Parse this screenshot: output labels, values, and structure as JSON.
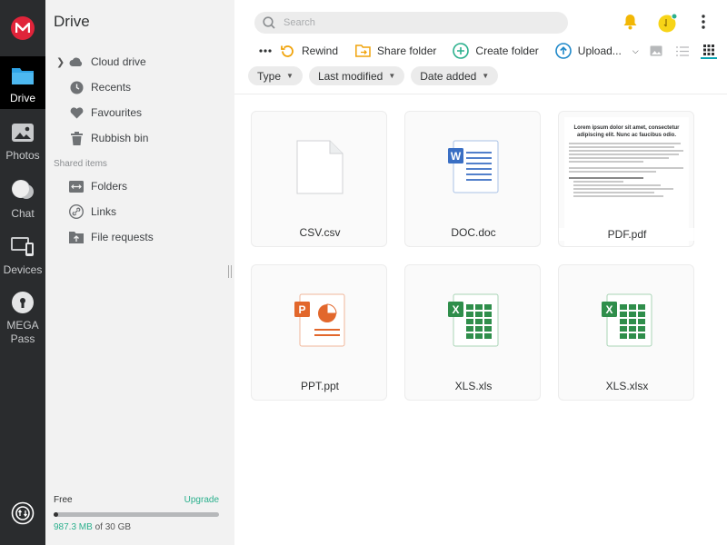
{
  "app": {
    "section_title": "Drive"
  },
  "rail": {
    "items": [
      {
        "label": "Drive",
        "icon": "folder-icon"
      },
      {
        "label": "Photos",
        "icon": "photos-icon"
      },
      {
        "label": "Chat",
        "icon": "chat-icon"
      },
      {
        "label": "Devices",
        "icon": "devices-icon"
      },
      {
        "label_line1": "MEGA",
        "label_line2": "Pass",
        "icon": "lock-icon"
      }
    ]
  },
  "sidebar": {
    "items": [
      {
        "label": "Cloud drive",
        "icon": "cloud-icon"
      },
      {
        "label": "Recents",
        "icon": "clock-icon"
      },
      {
        "label": "Favourites",
        "icon": "heart-icon"
      },
      {
        "label": "Rubbish bin",
        "icon": "trash-icon"
      }
    ],
    "shared_section": "Shared items",
    "shared_items": [
      {
        "label": "Folders",
        "icon": "shared-folder-icon"
      },
      {
        "label": "Links",
        "icon": "link-icon"
      },
      {
        "label": "File requests",
        "icon": "file-request-icon"
      }
    ],
    "storage": {
      "plan": "Free",
      "upgrade": "Upgrade",
      "used": "987.3 MB",
      "total_text": " of 30 GB",
      "used_fraction": 0.03
    }
  },
  "search": {
    "placeholder": "Search"
  },
  "toolbar": {
    "rewind": "Rewind",
    "share_folder": "Share folder",
    "create_folder": "Create folder",
    "upload": "Upload..."
  },
  "filters": [
    "Type",
    "Last modified",
    "Date added"
  ],
  "files": [
    {
      "name": "CSV.csv",
      "type": "csv"
    },
    {
      "name": "DOC.doc",
      "type": "doc"
    },
    {
      "name": "PDF.pdf",
      "type": "pdf"
    },
    {
      "name": "PPT.ppt",
      "type": "ppt"
    },
    {
      "name": "XLS.xls",
      "type": "xls"
    },
    {
      "name": "XLS.xlsx",
      "type": "xlsx"
    }
  ],
  "pdf_preview": {
    "title": "Lorem ipsum dolor sit amet, consectetur adipiscing elit. Nunc ac faucibus odio."
  },
  "colors": {
    "accent": "#0aa4b3",
    "brand": "#e0243a",
    "storage_used": "#2bb08d",
    "word_blue": "#3a6fc4",
    "ppt_orange": "#e2672c",
    "excel_green": "#2f8e4b"
  }
}
